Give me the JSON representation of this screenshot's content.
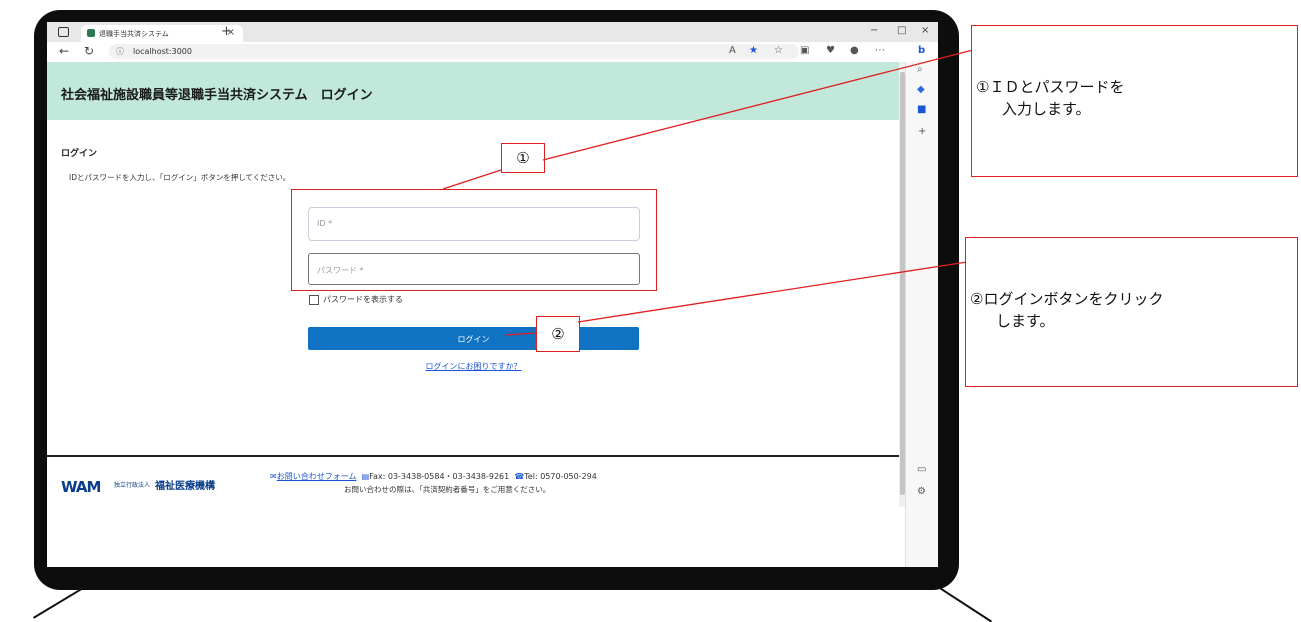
{
  "browser": {
    "tab_title": "退職手当共済システム",
    "tab_close": "×",
    "new_tab": "+",
    "url": "localhost:3000",
    "window_controls": [
      "−",
      "□",
      "×"
    ]
  },
  "page": {
    "header_title": "社会福祉施設職員等退職手当共済システム　ログイン",
    "section_title": "ログイン",
    "instruction": "IDとパスワードを入力し、「ログイン」ボタンを押してください。",
    "id_placeholder": "ID *",
    "password_placeholder": "パスワード *",
    "show_password_label": "パスワードを表示する",
    "login_button": "ログイン",
    "help_link": "ログインにお困りですか？"
  },
  "footer": {
    "logo_text": "WAM",
    "logo_sub": "独立行政法人",
    "logo_main": "福祉医療機構",
    "contact_form": "お問い合わせフォーム",
    "fax": "Fax: 03-3438-0584・03-3438-9261",
    "tel": "Tel: 0570-050-294",
    "notice": "お問い合わせの際は、「共済契約者番号」をご用意ください。"
  },
  "annotations": {
    "marker1": "①",
    "marker2": "②",
    "callout1_line1": "①ＩＤとパスワードを",
    "callout1_line2": "入力します。",
    "callout2_line1": "②ログインボタンをクリック",
    "callout2_line2": "します。"
  },
  "colors": {
    "header_bg": "#c1e8da",
    "login_button": "#0f72c3",
    "annotation_red": "#e02020"
  }
}
